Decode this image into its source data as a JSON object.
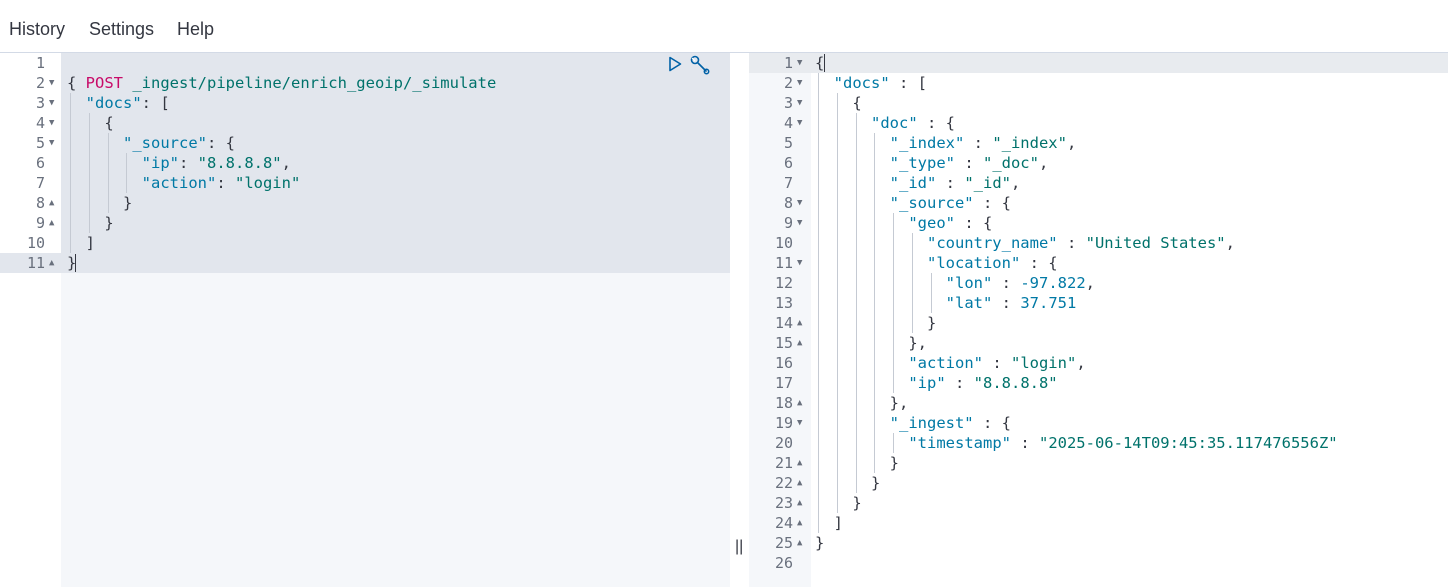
{
  "menu": {
    "history": "History",
    "settings": "Settings",
    "help": "Help"
  },
  "request": {
    "method": "POST",
    "url": "_ingest/pipeline/enrich_geoip/_simulate",
    "line_numbers": [
      "1",
      "2",
      "3",
      "4",
      "5",
      "6",
      "7",
      "8",
      "9",
      "10",
      "11"
    ],
    "lines": [
      [
        {
          "t": "{",
          "c": "punc"
        }
      ],
      [
        {
          "t": "  ",
          "c": "punc"
        },
        {
          "t": "\"docs\"",
          "c": "key"
        },
        {
          "t": ": [",
          "c": "punc"
        }
      ],
      [
        {
          "t": "    {",
          "c": "punc"
        }
      ],
      [
        {
          "t": "      ",
          "c": "punc"
        },
        {
          "t": "\"_source\"",
          "c": "key"
        },
        {
          "t": ": {",
          "c": "punc"
        }
      ],
      [
        {
          "t": "        ",
          "c": "punc"
        },
        {
          "t": "\"ip\"",
          "c": "key"
        },
        {
          "t": ": ",
          "c": "punc"
        },
        {
          "t": "\"8.8.8.8\"",
          "c": "str"
        },
        {
          "t": ",",
          "c": "punc"
        }
      ],
      [
        {
          "t": "        ",
          "c": "punc"
        },
        {
          "t": "\"action\"",
          "c": "key"
        },
        {
          "t": ": ",
          "c": "punc"
        },
        {
          "t": "\"login\"",
          "c": "str"
        }
      ],
      [
        {
          "t": "      }",
          "c": "punc"
        }
      ],
      [
        {
          "t": "    }",
          "c": "punc"
        }
      ],
      [
        {
          "t": "  ]",
          "c": "punc"
        }
      ],
      [
        {
          "t": "}",
          "c": "punc"
        }
      ]
    ]
  },
  "response": {
    "line_numbers": [
      "1",
      "2",
      "3",
      "4",
      "5",
      "6",
      "7",
      "8",
      "9",
      "10",
      "11",
      "12",
      "13",
      "14",
      "15",
      "16",
      "17",
      "18",
      "19",
      "20",
      "21",
      "22",
      "23",
      "24",
      "25",
      "26"
    ],
    "lines": [
      [
        {
          "t": "{",
          "c": "punc"
        }
      ],
      [
        {
          "t": "  ",
          "c": "punc"
        },
        {
          "t": "\"docs\"",
          "c": "key"
        },
        {
          "t": " : [",
          "c": "punc"
        }
      ],
      [
        {
          "t": "    {",
          "c": "punc"
        }
      ],
      [
        {
          "t": "      ",
          "c": "punc"
        },
        {
          "t": "\"doc\"",
          "c": "key"
        },
        {
          "t": " : {",
          "c": "punc"
        }
      ],
      [
        {
          "t": "        ",
          "c": "punc"
        },
        {
          "t": "\"_index\"",
          "c": "key"
        },
        {
          "t": " : ",
          "c": "punc"
        },
        {
          "t": "\"_index\"",
          "c": "str"
        },
        {
          "t": ",",
          "c": "punc"
        }
      ],
      [
        {
          "t": "        ",
          "c": "punc"
        },
        {
          "t": "\"_type\"",
          "c": "key"
        },
        {
          "t": " : ",
          "c": "punc"
        },
        {
          "t": "\"_doc\"",
          "c": "str"
        },
        {
          "t": ",",
          "c": "punc"
        }
      ],
      [
        {
          "t": "        ",
          "c": "punc"
        },
        {
          "t": "\"_id\"",
          "c": "key"
        },
        {
          "t": " : ",
          "c": "punc"
        },
        {
          "t": "\"_id\"",
          "c": "str"
        },
        {
          "t": ",",
          "c": "punc"
        }
      ],
      [
        {
          "t": "        ",
          "c": "punc"
        },
        {
          "t": "\"_source\"",
          "c": "key"
        },
        {
          "t": " : {",
          "c": "punc"
        }
      ],
      [
        {
          "t": "          ",
          "c": "punc"
        },
        {
          "t": "\"geo\"",
          "c": "key"
        },
        {
          "t": " : {",
          "c": "punc"
        }
      ],
      [
        {
          "t": "            ",
          "c": "punc"
        },
        {
          "t": "\"country_name\"",
          "c": "key"
        },
        {
          "t": " : ",
          "c": "punc"
        },
        {
          "t": "\"United States\"",
          "c": "str"
        },
        {
          "t": ",",
          "c": "punc"
        }
      ],
      [
        {
          "t": "            ",
          "c": "punc"
        },
        {
          "t": "\"location\"",
          "c": "key"
        },
        {
          "t": " : {",
          "c": "punc"
        }
      ],
      [
        {
          "t": "              ",
          "c": "punc"
        },
        {
          "t": "\"lon\"",
          "c": "key"
        },
        {
          "t": " : ",
          "c": "punc"
        },
        {
          "t": "-97.822",
          "c": "num"
        },
        {
          "t": ",",
          "c": "punc"
        }
      ],
      [
        {
          "t": "              ",
          "c": "punc"
        },
        {
          "t": "\"lat\"",
          "c": "key"
        },
        {
          "t": " : ",
          "c": "punc"
        },
        {
          "t": "37.751",
          "c": "num"
        }
      ],
      [
        {
          "t": "            }",
          "c": "punc"
        }
      ],
      [
        {
          "t": "          },",
          "c": "punc"
        }
      ],
      [
        {
          "t": "          ",
          "c": "punc"
        },
        {
          "t": "\"action\"",
          "c": "key"
        },
        {
          "t": " : ",
          "c": "punc"
        },
        {
          "t": "\"login\"",
          "c": "str"
        },
        {
          "t": ",",
          "c": "punc"
        }
      ],
      [
        {
          "t": "          ",
          "c": "punc"
        },
        {
          "t": "\"ip\"",
          "c": "key"
        },
        {
          "t": " : ",
          "c": "punc"
        },
        {
          "t": "\"8.8.8.8\"",
          "c": "str"
        }
      ],
      [
        {
          "t": "        },",
          "c": "punc"
        }
      ],
      [
        {
          "t": "        ",
          "c": "punc"
        },
        {
          "t": "\"_ingest\"",
          "c": "key"
        },
        {
          "t": " : {",
          "c": "punc"
        }
      ],
      [
        {
          "t": "          ",
          "c": "punc"
        },
        {
          "t": "\"timestamp\"",
          "c": "key"
        },
        {
          "t": " : ",
          "c": "punc"
        },
        {
          "t": "\"2025-06-14T09:45:35.117476556Z\"",
          "c": "str"
        }
      ],
      [
        {
          "t": "        }",
          "c": "punc"
        }
      ],
      [
        {
          "t": "      }",
          "c": "punc"
        }
      ],
      [
        {
          "t": "    }",
          "c": "punc"
        }
      ],
      [
        {
          "t": "  ]",
          "c": "punc"
        }
      ],
      [
        {
          "t": "}",
          "c": "punc"
        }
      ],
      []
    ]
  },
  "icons": {
    "run": "play-icon",
    "settings": "wrench-icon",
    "divider": "resize-handle-icon"
  },
  "divider_glyph": "||"
}
